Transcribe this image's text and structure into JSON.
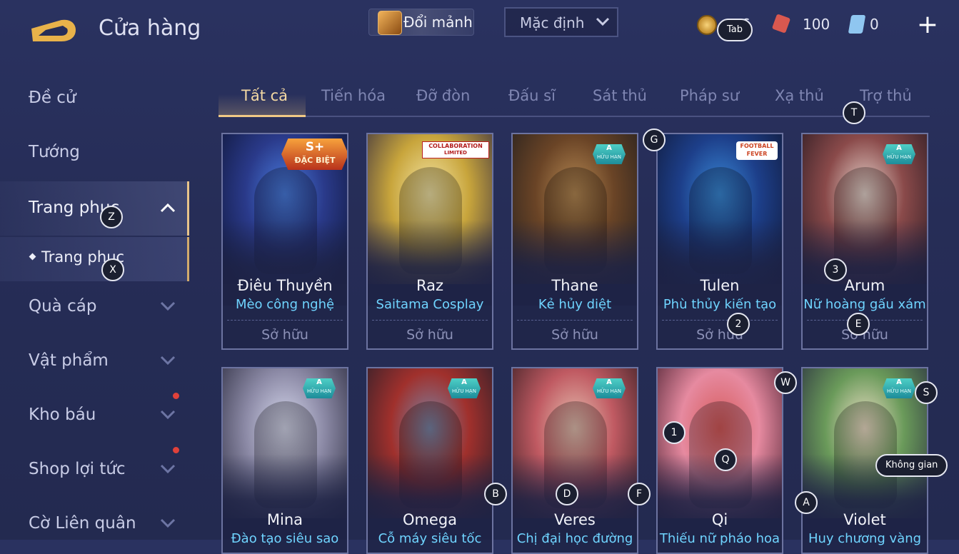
{
  "header": {
    "title": "Cửa hàng",
    "exchange_label": "Đổi mảnh",
    "sort_value": "Mặc định",
    "currencies": [
      {
        "name": "coin",
        "value": "6"
      },
      {
        "name": "gem",
        "value": "100"
      },
      {
        "name": "card",
        "value": "0"
      }
    ],
    "add_label": "+"
  },
  "sidebar": {
    "items": [
      {
        "label": "Đề cử",
        "chevron": false
      },
      {
        "label": "Tướng",
        "chevron": false
      },
      {
        "label": "Trang phục",
        "chevron": "up",
        "active": true
      },
      {
        "label": "Trang phục",
        "sub": true
      },
      {
        "label": "Quà cáp",
        "chevron": "down"
      },
      {
        "label": "Vật phẩm",
        "chevron": "down"
      },
      {
        "label": "Kho báu",
        "chevron": "down",
        "notification": true
      },
      {
        "label": "Shop lợi tức",
        "chevron": "down",
        "notification": true
      },
      {
        "label": "Cờ Liên quân",
        "chevron": "down"
      }
    ]
  },
  "tabs": [
    "Tất cả",
    "Tiến hóa",
    "Đỡ đòn",
    "Đấu sĩ",
    "Sát thủ",
    "Pháp sư",
    "Xạ thủ",
    "Trợ thủ"
  ],
  "active_tab": 0,
  "cards": [
    {
      "hero": "Điêu Thuyền",
      "skin": "Mèo công nghệ",
      "status": "Sở hữu",
      "badge_type": "s-plus",
      "badge_l1": "S+",
      "badge_l2": "ĐẶC BIỆT",
      "art": [
        "#4a7de0",
        "#2a3a8a",
        "#0f1638"
      ]
    },
    {
      "hero": "Raz",
      "skin": "Saitama Cosplay",
      "status": "Sở hữu",
      "badge_type": "collab",
      "badge_l1": "COLLABORATION",
      "badge_l2": "LIMITED",
      "art": [
        "#f4e6a8",
        "#c8a53c",
        "#3a3040"
      ]
    },
    {
      "hero": "Thane",
      "skin": "Kẻ hủy diệt",
      "status": "Sở hữu",
      "badge_type": "a",
      "badge_l1": "A",
      "badge_l2": "HỮU HẠN",
      "art": [
        "#b78a54",
        "#6a4426",
        "#25201e"
      ]
    },
    {
      "hero": "Tulen",
      "skin": "Phù thủy kiến tạo",
      "status": "Sở hữu",
      "badge_type": "football",
      "badge_l1": "FOOTBALL",
      "badge_l2": "FEVER",
      "art": [
        "#3a8ad8",
        "#1d3f8a",
        "#101836"
      ]
    },
    {
      "hero": "Arum",
      "skin": "Nữ hoàng gấu xám",
      "status": "Sở hữu",
      "badge_type": "a",
      "badge_l1": "A",
      "badge_l2": "HỮU HẠN",
      "art": [
        "#e9d7cf",
        "#8a4a4a",
        "#2a1a22"
      ]
    },
    {
      "hero": "Mina",
      "skin": "Đào tạo siêu sao",
      "status": "",
      "badge_type": "a",
      "badge_l1": "A",
      "badge_l2": "HỮU HẠN",
      "art": [
        "#d7d9ee",
        "#8c8aa6",
        "#2c2c40"
      ]
    },
    {
      "hero": "Omega",
      "skin": "Cỗ máy siêu tốc",
      "status": "",
      "badge_type": "a",
      "badge_l1": "A",
      "badge_l2": "HỮU HẠN",
      "art": [
        "#7a86a8",
        "#a0302c",
        "#2a1f2a"
      ]
    },
    {
      "hero": "Veres",
      "skin": "Chị đại học đường",
      "status": "",
      "badge_type": "a",
      "badge_l1": "A",
      "badge_l2": "HỮU HẠN",
      "art": [
        "#e6c2b2",
        "#c05a62",
        "#3a1f24"
      ]
    },
    {
      "hero": "Qi",
      "skin": "Thiếu nữ pháo hoa",
      "status": "",
      "badge_type": "none",
      "badge_l1": "",
      "badge_l2": "",
      "art": [
        "#d65a5a",
        "#e68aa0",
        "#4a1f30"
      ]
    },
    {
      "hero": "Violet",
      "skin": "Huy chương vàng",
      "status": "",
      "badge_type": "a",
      "badge_l1": "A",
      "badge_l2": "HỮU HẠN",
      "art": [
        "#f0e0c8",
        "#6a9a5a",
        "#2a3040"
      ]
    }
  ],
  "key_hints": [
    "Tab",
    "Z",
    "X",
    "G",
    "T",
    "3",
    "2",
    "E",
    "W",
    "S",
    "1",
    "Q",
    "Không gian",
    "B",
    "D",
    "F",
    "A"
  ]
}
